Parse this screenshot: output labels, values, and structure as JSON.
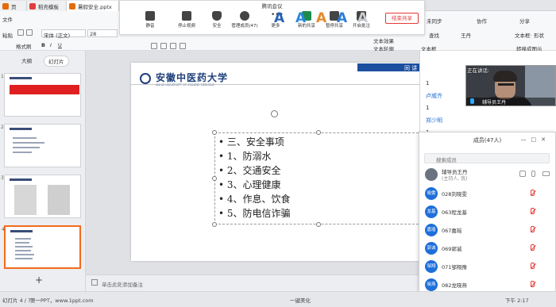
{
  "tabs": [
    {
      "label": "页",
      "color": "#e36c0a"
    },
    {
      "label": "稻壳模板",
      "color": "#e23d3d"
    },
    {
      "label": "暑假安全.pptx",
      "color": "#e36c0a"
    }
  ],
  "ribbon": {
    "left_items": [
      "文件",
      "粘贴",
      "格式刷"
    ],
    "font_name": "宋体 (正文)",
    "font_size": "28",
    "right_items": [
      "未同步",
      "协作",
      "分享",
      "查找",
      "文本框",
      "文本效果",
      "文本轮廓",
      "转换成图示"
    ],
    "user": "王丹",
    "right_col2": [
      "文本框·",
      "形状"
    ]
  },
  "meeting": {
    "title": "腾讯会议",
    "buttons": [
      "静音",
      "停止视频",
      "安全",
      "管理成员(47)",
      "更多",
      "新的共享",
      "暂停共享",
      "开启批注"
    ],
    "end_share": "结束共享",
    "colors": [
      "#2a62b5",
      "#2a8ae0",
      "#e58a2a",
      "#2e7dd8",
      "#c9ccd1",
      "#6a6d72"
    ]
  },
  "left_panel": {
    "tabs": [
      "大纲",
      "幻灯片"
    ],
    "slide_numbers": [
      "1",
      "2",
      "3",
      "4"
    ]
  },
  "slide": {
    "header": "同 讲",
    "university_name": "安徽中医药大学",
    "university_sub": "ANHUI UNIVERSITY OF CHINESE MEDICINE",
    "bullets": [
      "三、安全事项",
      "1、防溺水",
      "2、交通安全",
      "3、心理健康",
      "4、作息、饮食",
      "5、防电信诈骗"
    ]
  },
  "notes": {
    "placeholder": "单击此处添加备注"
  },
  "status": {
    "slide_counter": "幻灯片 4 / 7",
    "theme": "第一PPT，www.1ppt.com",
    "beautify": "一键美化",
    "time": "下午 2:17"
  },
  "chat": {
    "lines": [
      "1",
      "卢威齐",
      "1",
      "郑少明",
      "1"
    ]
  },
  "video": {
    "label": "正在讲话:",
    "name": "辅导员王丹"
  },
  "members": {
    "title": "成员(47人)",
    "search_placeholder": "搜索成员",
    "host": {
      "name": "辅导员王丹",
      "role": "(主持人, 我)"
    },
    "list": [
      {
        "avatar": "晓雯",
        "name": "028刘晓雯"
      },
      {
        "avatar": "龙基",
        "name": "063程龙基"
      },
      {
        "avatar": "嘉瑶",
        "name": "067嘉瑶"
      },
      {
        "avatar": "郭诚",
        "name": "069郭诚"
      },
      {
        "avatar": "邹翔",
        "name": "071邹翔豫"
      },
      {
        "avatar": "晓燕",
        "name": "082龙晓燕"
      }
    ],
    "avatar_color": "#1e6fd9"
  }
}
